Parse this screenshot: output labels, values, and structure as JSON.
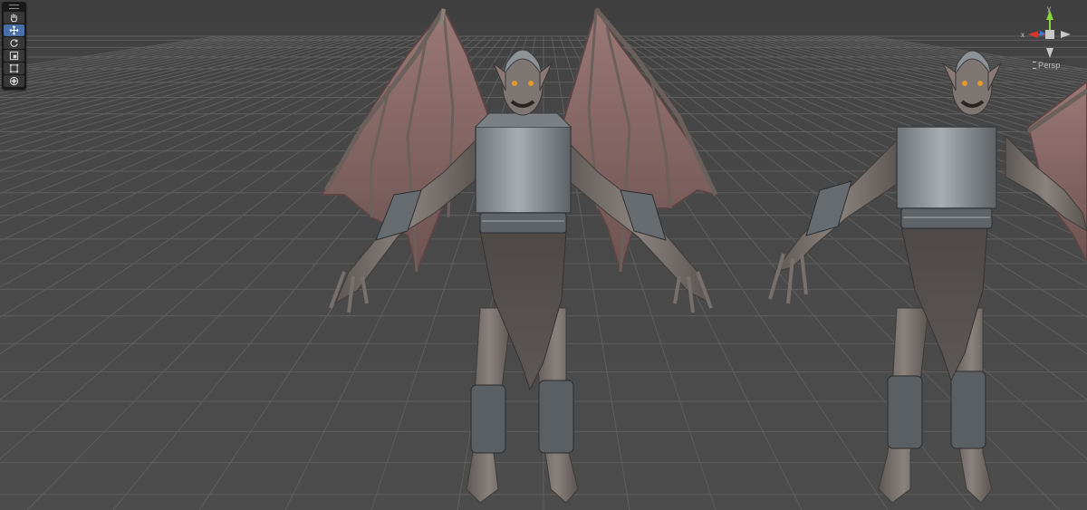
{
  "scene_view": {
    "projection_label": "Persp",
    "gizmo": {
      "x_axis_label": "x",
      "y_axis_label": "y",
      "x_color": "#d9342b",
      "y_color": "#8bd33d",
      "z_color": "#3c7de0",
      "neutral_color": "#c8c8c8"
    },
    "grid_color": "#5f5f5f",
    "background_color": "#474747"
  },
  "toolbar": {
    "active_tool": "move",
    "tools": [
      {
        "name": "hand",
        "icon": "hand-icon"
      },
      {
        "name": "move",
        "icon": "move-arrows-icon"
      },
      {
        "name": "rotate",
        "icon": "rotate-icon"
      },
      {
        "name": "scale",
        "icon": "scale-icon"
      },
      {
        "name": "rect",
        "icon": "rect-transform-icon"
      },
      {
        "name": "transform",
        "icon": "transform-icon"
      }
    ]
  },
  "models": [
    {
      "name": "gargoyle-model-front",
      "skin_color": "#7b7470",
      "wing_color": "#8a6a68",
      "armor_color": "#8e9396"
    },
    {
      "name": "gargoyle-model-side",
      "skin_color": "#7b7470",
      "wing_color": "#8a6a68",
      "armor_color": "#8e9396"
    }
  ]
}
